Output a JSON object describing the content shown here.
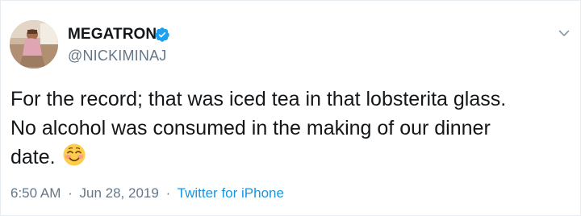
{
  "tweet": {
    "display_name": "MEGATRON",
    "handle": "@NICKIMINAJ",
    "verified": true,
    "text_lines": [
      "For the record; that was iced tea in that lobsterita glass.",
      "No alcohol was consumed in the making of our dinner",
      "date."
    ],
    "emoji": "smiling-face-with-smiling-eyes",
    "time": "6:50 AM",
    "date": "Jun 28, 2019",
    "separator": "·",
    "source": "Twitter for iPhone"
  },
  "colors": {
    "text": "#14171a",
    "secondary": "#657786",
    "link": "#1b95e0",
    "verified": "#1da1f2",
    "border": "#e6ecf0"
  },
  "icons": {
    "verified": "verified-badge-icon",
    "menu": "chevron-down-icon"
  }
}
